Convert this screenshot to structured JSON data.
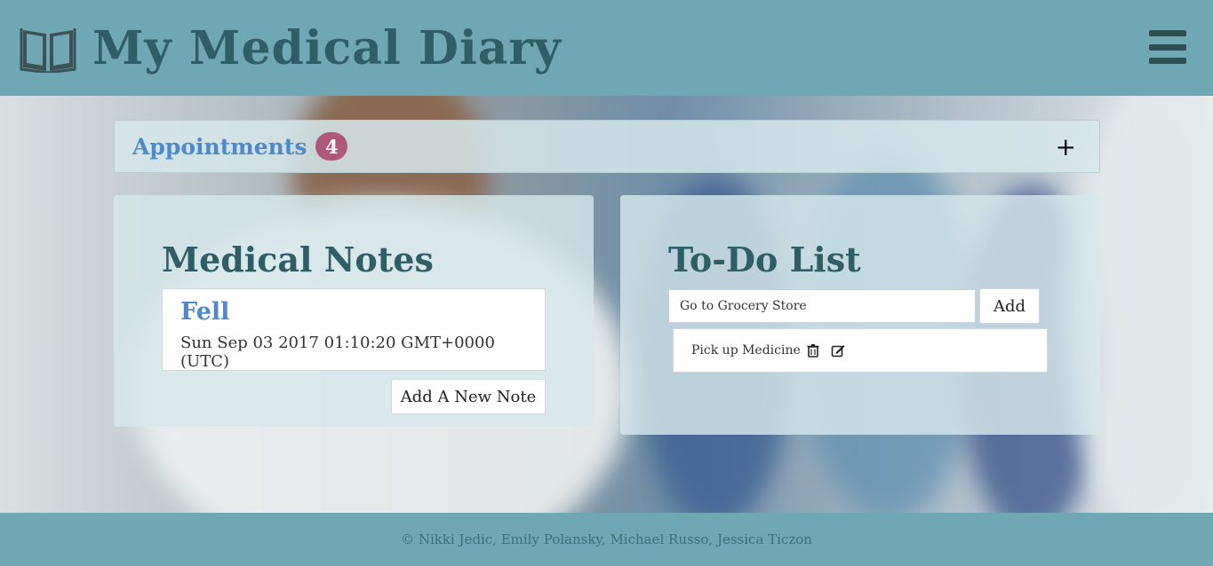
{
  "app": {
    "title": "My Medical Diary",
    "brand_icon": "open-book-icon",
    "menu_icon": "hamburger-menu-icon"
  },
  "appointments": {
    "label": "Appointments",
    "count": "4",
    "toggle_label": "+"
  },
  "medical_notes": {
    "heading": "Medical Notes",
    "notes": [
      {
        "title": "Fell",
        "date": "Sun Sep 03 2017 01:10:20 GMT+0000 (UTC)"
      }
    ],
    "add_button_label": "Add A New Note"
  },
  "todo": {
    "heading": "To-Do List",
    "input_value": "Go to Grocery Store",
    "add_button_label": "Add",
    "items": [
      {
        "label": "Pick up Medicine",
        "delete_icon": "trash-icon",
        "edit_icon": "edit-icon"
      }
    ]
  },
  "footer": {
    "text": "© Nikki Jedic, Emily Polansky, Michael Russo, Jessica Ticzon"
  },
  "colors": {
    "navbar": "#6fa8b3",
    "title_text": "#2f5e66",
    "accent_blue": "#4f89c7",
    "badge": "#b0577c"
  }
}
